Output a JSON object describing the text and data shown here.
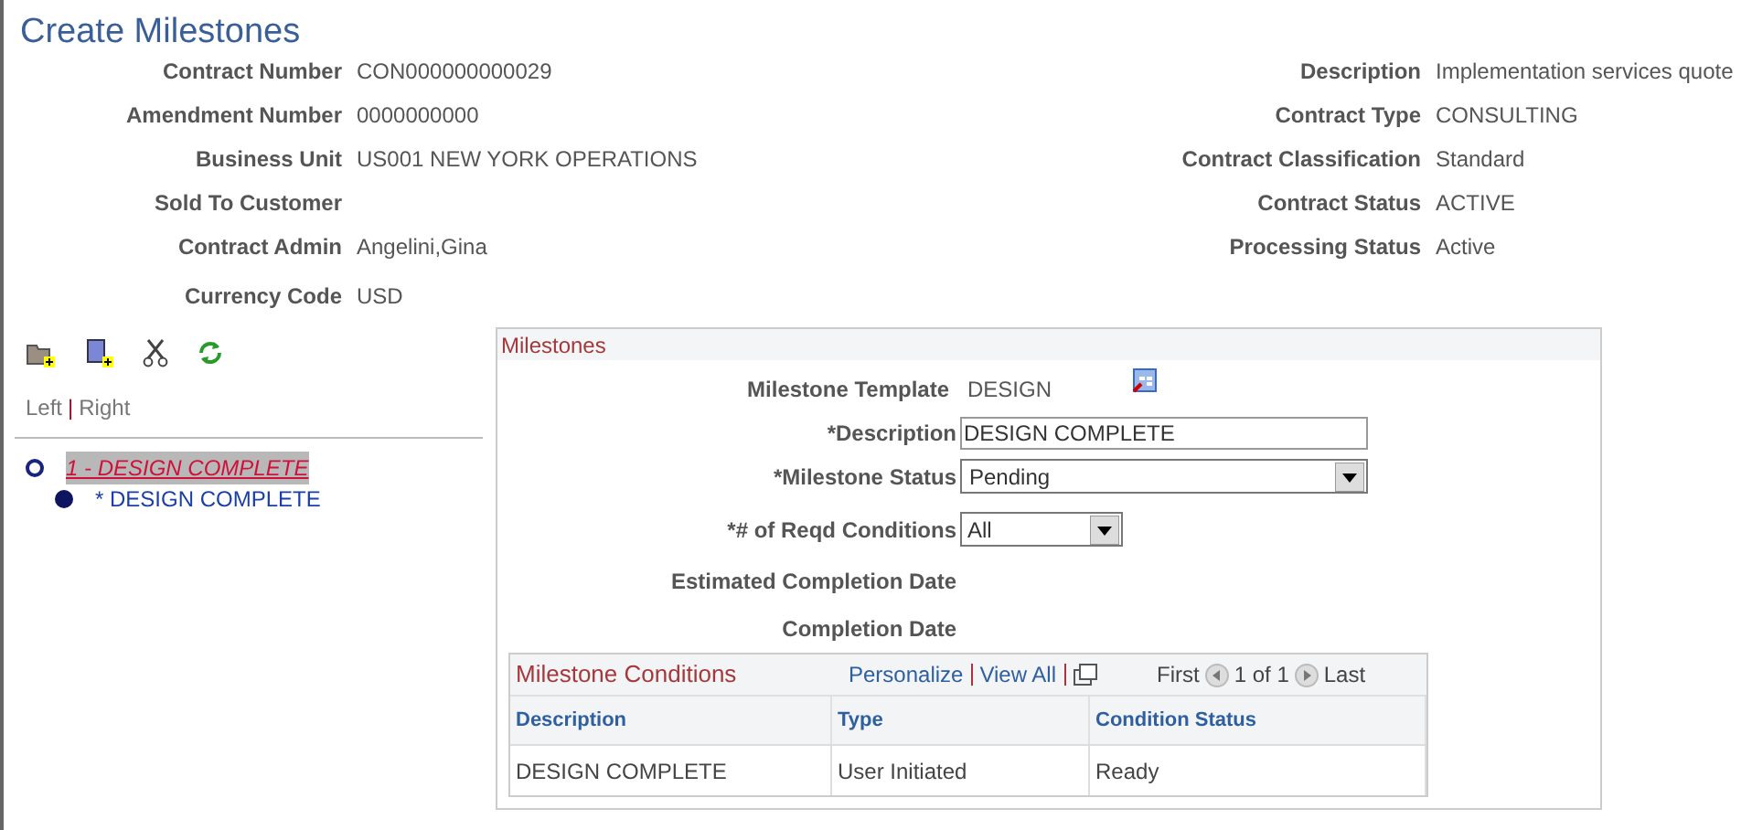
{
  "title": "Create Milestones",
  "header_left": [
    {
      "label": "Contract Number",
      "value": "CON000000000029"
    },
    {
      "label": "Amendment Number",
      "value": "0000000000"
    },
    {
      "label": "Business Unit",
      "value": "US001 NEW YORK OPERATIONS"
    },
    {
      "label": "Sold To Customer"
    },
    {
      "label": "Contract Admin",
      "value": "Angelini,Gina"
    },
    {
      "label": "Currency Code",
      "value": "USD"
    }
  ],
  "header_right": [
    {
      "label": "Description",
      "value": "Implementation services quote"
    },
    {
      "label": "Contract Type",
      "value": "CONSULTING"
    },
    {
      "label": "Contract Classification",
      "value": "Standard"
    },
    {
      "label": "Contract Status",
      "value": "ACTIVE"
    },
    {
      "label": "Processing Status",
      "value": "Active"
    }
  ],
  "view_links": {
    "left": "Left",
    "separator": "|",
    "right": "Right"
  },
  "tree": [
    {
      "label": "1 - DESIGN COMPLETE",
      "selected": true,
      "children": [
        {
          "label": "* DESIGN COMPLETE",
          "selected": false
        }
      ]
    }
  ],
  "milestones": {
    "title": "Milestones",
    "template_label": "Milestone Template",
    "template_value": "DESIGN",
    "description_label": "*Description",
    "description_value": "DESIGN COMPLETE",
    "status_label": "*Milestone Status",
    "status_value": "Pending",
    "conditions_label": "*# of Reqd Conditions",
    "conditions_value": "All",
    "est_date_label": "Estimated Completion Date",
    "completion_date_label": "Completion Date",
    "grid": {
      "title": "Milestone Conditions",
      "personalize": "Personalize",
      "view_all": "View All",
      "first": "First",
      "page": "1 of 1",
      "last": "Last",
      "columns": [
        "Description",
        "Type",
        "Condition Status"
      ],
      "rows": [
        [
          "DESIGN COMPLETE",
          "User Initiated",
          "Ready"
        ]
      ]
    }
  }
}
